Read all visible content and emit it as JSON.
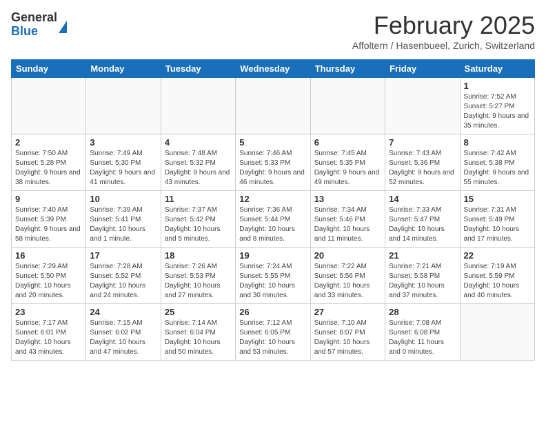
{
  "header": {
    "logo_general": "General",
    "logo_blue": "Blue",
    "month_title": "February 2025",
    "location": "Affoltern / Hasenbueel, Zurich, Switzerland"
  },
  "weekdays": [
    "Sunday",
    "Monday",
    "Tuesday",
    "Wednesday",
    "Thursday",
    "Friday",
    "Saturday"
  ],
  "weeks": [
    [
      {
        "day": "",
        "info": ""
      },
      {
        "day": "",
        "info": ""
      },
      {
        "day": "",
        "info": ""
      },
      {
        "day": "",
        "info": ""
      },
      {
        "day": "",
        "info": ""
      },
      {
        "day": "",
        "info": ""
      },
      {
        "day": "1",
        "info": "Sunrise: 7:52 AM\nSunset: 5:27 PM\nDaylight: 9 hours and 35 minutes."
      }
    ],
    [
      {
        "day": "2",
        "info": "Sunrise: 7:50 AM\nSunset: 5:28 PM\nDaylight: 9 hours and 38 minutes."
      },
      {
        "day": "3",
        "info": "Sunrise: 7:49 AM\nSunset: 5:30 PM\nDaylight: 9 hours and 41 minutes."
      },
      {
        "day": "4",
        "info": "Sunrise: 7:48 AM\nSunset: 5:32 PM\nDaylight: 9 hours and 43 minutes."
      },
      {
        "day": "5",
        "info": "Sunrise: 7:46 AM\nSunset: 5:33 PM\nDaylight: 9 hours and 46 minutes."
      },
      {
        "day": "6",
        "info": "Sunrise: 7:45 AM\nSunset: 5:35 PM\nDaylight: 9 hours and 49 minutes."
      },
      {
        "day": "7",
        "info": "Sunrise: 7:43 AM\nSunset: 5:36 PM\nDaylight: 9 hours and 52 minutes."
      },
      {
        "day": "8",
        "info": "Sunrise: 7:42 AM\nSunset: 5:38 PM\nDaylight: 9 hours and 55 minutes."
      }
    ],
    [
      {
        "day": "9",
        "info": "Sunrise: 7:40 AM\nSunset: 5:39 PM\nDaylight: 9 hours and 58 minutes."
      },
      {
        "day": "10",
        "info": "Sunrise: 7:39 AM\nSunset: 5:41 PM\nDaylight: 10 hours and 1 minute."
      },
      {
        "day": "11",
        "info": "Sunrise: 7:37 AM\nSunset: 5:42 PM\nDaylight: 10 hours and 5 minutes."
      },
      {
        "day": "12",
        "info": "Sunrise: 7:36 AM\nSunset: 5:44 PM\nDaylight: 10 hours and 8 minutes."
      },
      {
        "day": "13",
        "info": "Sunrise: 7:34 AM\nSunset: 5:46 PM\nDaylight: 10 hours and 11 minutes."
      },
      {
        "day": "14",
        "info": "Sunrise: 7:33 AM\nSunset: 5:47 PM\nDaylight: 10 hours and 14 minutes."
      },
      {
        "day": "15",
        "info": "Sunrise: 7:31 AM\nSunset: 5:49 PM\nDaylight: 10 hours and 17 minutes."
      }
    ],
    [
      {
        "day": "16",
        "info": "Sunrise: 7:29 AM\nSunset: 5:50 PM\nDaylight: 10 hours and 20 minutes."
      },
      {
        "day": "17",
        "info": "Sunrise: 7:28 AM\nSunset: 5:52 PM\nDaylight: 10 hours and 24 minutes."
      },
      {
        "day": "18",
        "info": "Sunrise: 7:26 AM\nSunset: 5:53 PM\nDaylight: 10 hours and 27 minutes."
      },
      {
        "day": "19",
        "info": "Sunrise: 7:24 AM\nSunset: 5:55 PM\nDaylight: 10 hours and 30 minutes."
      },
      {
        "day": "20",
        "info": "Sunrise: 7:22 AM\nSunset: 5:56 PM\nDaylight: 10 hours and 33 minutes."
      },
      {
        "day": "21",
        "info": "Sunrise: 7:21 AM\nSunset: 5:58 PM\nDaylight: 10 hours and 37 minutes."
      },
      {
        "day": "22",
        "info": "Sunrise: 7:19 AM\nSunset: 5:59 PM\nDaylight: 10 hours and 40 minutes."
      }
    ],
    [
      {
        "day": "23",
        "info": "Sunrise: 7:17 AM\nSunset: 6:01 PM\nDaylight: 10 hours and 43 minutes."
      },
      {
        "day": "24",
        "info": "Sunrise: 7:15 AM\nSunset: 6:02 PM\nDaylight: 10 hours and 47 minutes."
      },
      {
        "day": "25",
        "info": "Sunrise: 7:14 AM\nSunset: 6:04 PM\nDaylight: 10 hours and 50 minutes."
      },
      {
        "day": "26",
        "info": "Sunrise: 7:12 AM\nSunset: 6:05 PM\nDaylight: 10 hours and 53 minutes."
      },
      {
        "day": "27",
        "info": "Sunrise: 7:10 AM\nSunset: 6:07 PM\nDaylight: 10 hours and 57 minutes."
      },
      {
        "day": "28",
        "info": "Sunrise: 7:08 AM\nSunset: 6:08 PM\nDaylight: 11 hours and 0 minutes."
      },
      {
        "day": "",
        "info": ""
      }
    ]
  ]
}
